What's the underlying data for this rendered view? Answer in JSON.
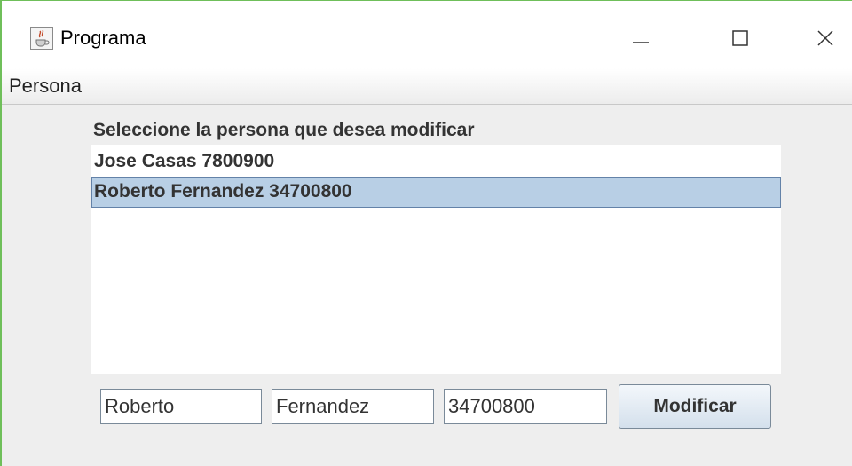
{
  "window": {
    "title": "Programa",
    "icon": "java-cup-icon"
  },
  "menubar": {
    "items": [
      {
        "label": "Persona"
      }
    ]
  },
  "main": {
    "instruction": "Seleccione la persona que desea modificar",
    "list": {
      "items": [
        {
          "label": "Jose Casas 7800900",
          "selected": false
        },
        {
          "label": "Roberto Fernandez 34700800",
          "selected": true
        }
      ]
    },
    "form": {
      "nombre": "Roberto",
      "apellido": "Fernandez",
      "telefono": "34700800",
      "submit_label": "Modificar"
    }
  },
  "colors": {
    "selection_bg": "#b8cfe5",
    "selection_border": "#6382a8",
    "window_border": "#6fbf5a"
  }
}
